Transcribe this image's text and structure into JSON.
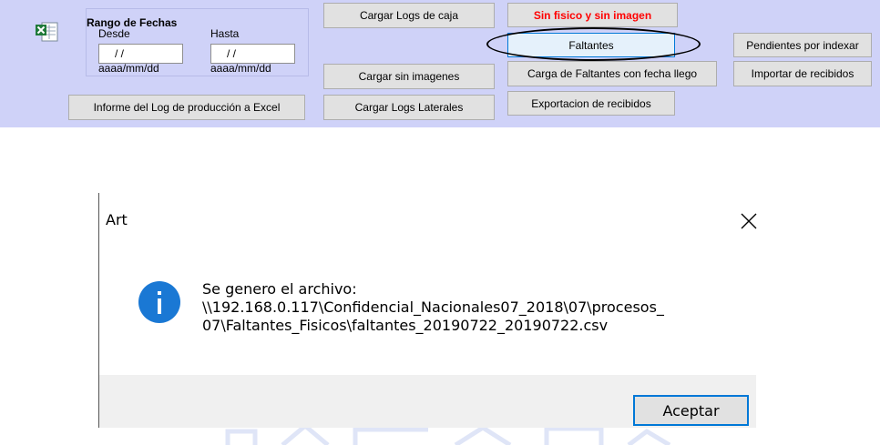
{
  "panel": {
    "date_range": {
      "title": "Rango de Fechas",
      "from_label": "Desde",
      "to_label": "Hasta",
      "from_value": " / /",
      "to_value": " / /",
      "from_format": "aaaa/mm/dd",
      "to_format": "aaaa/mm/dd"
    },
    "buttons": {
      "informe": "Informe del Log de producción a Excel",
      "cargar_logs_caja": "Cargar Logs de caja",
      "cargar_sin_imagenes": "Cargar sin imagenes",
      "cargar_logs_laterales": "Cargar Logs Laterales",
      "sin_fisico": "Sin fisico y sin imagen",
      "faltantes": "Faltantes",
      "carga_faltantes": "Carga de Faltantes con fecha llego",
      "exportacion": "Exportacion de recibidos",
      "pendientes": "Pendientes por indexar",
      "importar": "Importar de recibidos"
    },
    "colors": {
      "panel_bg": "#cfd2f8",
      "alert_text": "#ff0000",
      "focus_border": "#0078d7"
    }
  },
  "dialog": {
    "title": "Art",
    "message_line1": "Se genero el archivo:",
    "message_line2": "\\\\192.168.0.117\\Confidencial_Nacionales07_2018\\07\\procesos_",
    "message_line3": "07\\Faltantes_Fisicos\\faltantes_20190722_20190722.csv",
    "ok_label": "Aceptar",
    "icons": {
      "info": "info-icon",
      "close": "close-icon"
    }
  }
}
